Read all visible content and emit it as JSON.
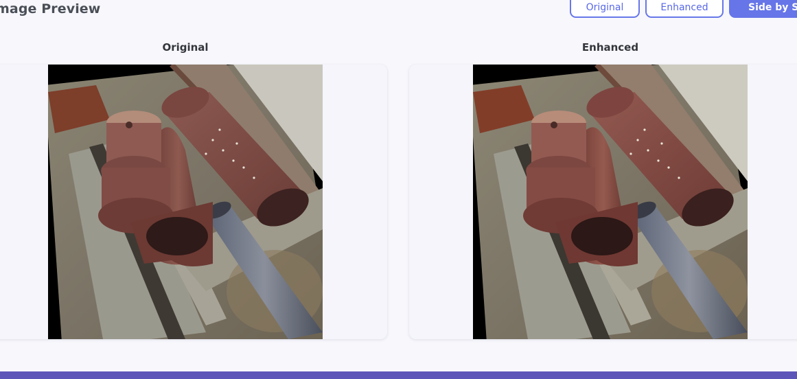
{
  "header": {
    "title": "mage Preview"
  },
  "view_modes": {
    "original_label": "Original",
    "enhanced_label": "Enhanced",
    "side_by_side_label": "Side by Side"
  },
  "panels": {
    "left_label": "Original",
    "right_label": "Enhanced"
  }
}
